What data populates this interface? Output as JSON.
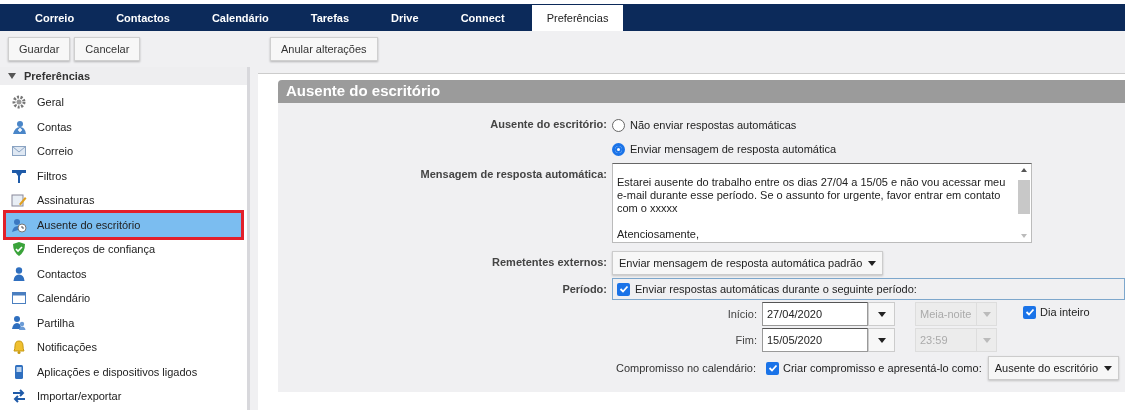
{
  "nav": {
    "tabs": [
      {
        "label": "Correio",
        "selected": false
      },
      {
        "label": "Contactos",
        "selected": false
      },
      {
        "label": "Calendário",
        "selected": false
      },
      {
        "label": "Tarefas",
        "selected": false
      },
      {
        "label": "Drive",
        "selected": false
      },
      {
        "label": "Connect",
        "selected": false
      },
      {
        "label": "Preferências",
        "selected": true
      }
    ]
  },
  "toolbar": {
    "left_buttons": [
      "Guardar",
      "Cancelar"
    ],
    "right_buttons": [
      "Anular alterações"
    ]
  },
  "sidebar": {
    "header": "Preferências",
    "expanded": true,
    "items": [
      {
        "label": "Geral",
        "selected": false
      },
      {
        "label": "Contas",
        "selected": false
      },
      {
        "label": "Correio",
        "selected": false
      },
      {
        "label": "Filtros",
        "selected": false
      },
      {
        "label": "Assinaturas",
        "selected": false
      },
      {
        "label": "Ausente do escritório",
        "selected": true
      },
      {
        "label": "Endereços de confiança",
        "selected": false
      },
      {
        "label": "Contactos",
        "selected": false
      },
      {
        "label": "Calendário",
        "selected": false
      },
      {
        "label": "Partilha",
        "selected": false
      },
      {
        "label": "Notificações",
        "selected": false
      },
      {
        "label": "Aplicações e dispositivos ligados",
        "selected": false
      },
      {
        "label": "Importar/exportar",
        "selected": false
      }
    ]
  },
  "panel": {
    "title": "Ausente do escritório",
    "out_of_office": {
      "label": "Ausente do escritório:",
      "options": [
        {
          "label": "Não enviar respostas automáticas",
          "selected": false
        },
        {
          "label": "Enviar mensagem de resposta automática",
          "selected": true
        }
      ]
    },
    "message": {
      "label": "Mensagem de resposta automática:",
      "value": "Estarei ausente do trabalho entre os dias 27/04 a 15/05 e não vou acessar meu e-mail durante esse período. Se o assunto for urgente, favor entrar em contato com o xxxxx\n\nAtenciosamente,"
    },
    "external": {
      "label": "Remetentes externos:",
      "value": "Enviar mensagem de resposta automática padrão"
    },
    "period": {
      "label": "Período:",
      "checkbox": {
        "label": "Enviar respostas automáticas durante o seguinte período:",
        "checked": true
      }
    },
    "start": {
      "label": "Início:",
      "date": "27/04/2020",
      "time": {
        "value": "Meia-noite",
        "disabled": true
      }
    },
    "all_day": {
      "label": "Dia inteiro",
      "checked": true
    },
    "end": {
      "label": "Fim:",
      "date": "15/05/2020",
      "time": {
        "value": "23:59",
        "disabled": true
      }
    },
    "calendar": {
      "label": "Compromisso no calendário:",
      "checkbox": {
        "label": "Criar compromisso e apresentá-lo como:",
        "checked": true
      },
      "value": "Ausente do escritório"
    }
  }
}
